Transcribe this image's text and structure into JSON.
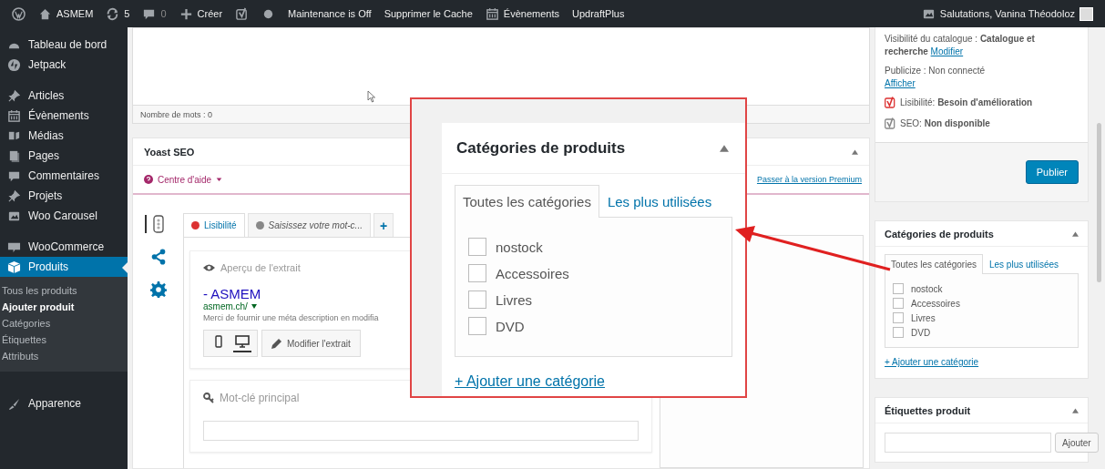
{
  "top_bar": {
    "items": [
      {
        "kind": "logo"
      },
      {
        "kind": "home",
        "label": "ASMEM"
      },
      {
        "kind": "updates",
        "label": "5"
      },
      {
        "kind": "comments",
        "label": "0"
      },
      {
        "kind": "new",
        "label": "Créer"
      },
      {
        "kind": "yoast"
      },
      {
        "kind": "status"
      },
      {
        "kind": "text",
        "label": "Maintenance is Off"
      },
      {
        "kind": "text",
        "label": "Supprimer le Cache"
      },
      {
        "kind": "calendar",
        "label": "Évènements"
      },
      {
        "kind": "text",
        "label": "UpdraftPlus"
      }
    ],
    "account": {
      "greeting": "Salutations, Vanina Théodoloz"
    }
  },
  "sidebar": {
    "groups": [
      [
        {
          "kind": "dashboard",
          "label": "Tableau de bord",
          "selected": false
        },
        {
          "kind": "jetpack",
          "label": "Jetpack",
          "selected": false
        }
      ],
      [
        {
          "kind": "pin",
          "label": "Articles",
          "selected": false
        },
        {
          "kind": "calendar",
          "label": "Évènements",
          "selected": false
        },
        {
          "kind": "media",
          "label": "Médias",
          "selected": false
        },
        {
          "kind": "pages",
          "label": "Pages",
          "selected": false
        },
        {
          "kind": "comments",
          "label": "Commentaires",
          "selected": false
        },
        {
          "kind": "pin",
          "label": "Projets",
          "selected": false
        },
        {
          "kind": "slides",
          "label": "Woo Carousel",
          "selected": false
        }
      ],
      [
        {
          "kind": "woo",
          "label": "WooCommerce",
          "selected": false
        },
        {
          "kind": "box",
          "label": "Produits",
          "selected": true,
          "children": [
            {
              "label": "Tous les produits",
              "selected": false
            },
            {
              "label": "Ajouter produit",
              "selected": true
            },
            {
              "label": "Catégories",
              "selected": false
            },
            {
              "label": "Étiquettes",
              "selected": false
            },
            {
              "label": "Attributs",
              "selected": false
            }
          ]
        }
      ],
      [
        {
          "kind": "brush",
          "label": "Apparence",
          "selected": false
        }
      ]
    ]
  },
  "editor": {
    "word_count": "Nombre de mots : 0"
  },
  "yoast": {
    "title": "Yoast SEO",
    "help_label": "Centre d'aide",
    "premium_link": "Passer à la version Premium",
    "side_tabs": [
      {
        "kind": "readability",
        "selected": true
      },
      {
        "kind": "social",
        "selected": false
      },
      {
        "kind": "settings",
        "selected": false
      }
    ],
    "tabs": [
      {
        "label": "Lisibilité",
        "color": "#dc3232",
        "selected": true,
        "kind": "analysis"
      },
      {
        "label": "Saisissez votre mot-c...",
        "color": "#888888",
        "selected": false,
        "kind": "analysis"
      },
      {
        "label": "+",
        "selected": false,
        "kind": "add"
      }
    ],
    "snippet": {
      "heading": "Aperçu de l'extrait",
      "title": "- ASMEM",
      "url": "asmem.ch/",
      "description": "Merci de fournir une méta description en modifia",
      "devices": [
        {
          "kind": "mobile",
          "selected": false
        },
        {
          "kind": "desktop",
          "selected": true
        }
      ],
      "edit_button": "Modifier l'extrait"
    },
    "keyword": {
      "label": "Mot-clé principal"
    }
  },
  "publish": {
    "visibility": "Visibilité du catalogue : **Catalogue et recherche**",
    "visibility_link": "Modifier",
    "publicize": "Publicize : Non connecté",
    "publicize_link": "Afficher",
    "scores": [
      {
        "text": "Lisibilité: **Besoin d'amélioration**",
        "color": "#dc3232"
      },
      {
        "text": "SEO: **Non disponible**",
        "color": "#888888"
      }
    ],
    "button": "Publier"
  },
  "categories": {
    "title": "Catégories de produits",
    "tabs": [
      {
        "label": "Toutes les catégories",
        "selected": true
      },
      {
        "label": "Les plus utilisées",
        "selected": false
      }
    ],
    "items": [
      {
        "label": "nostock",
        "checked": false
      },
      {
        "label": "Accessoires",
        "checked": false
      },
      {
        "label": "Livres",
        "checked": false
      },
      {
        "label": "DVD",
        "checked": false
      }
    ],
    "add_link": "+ Ajouter une catégorie"
  },
  "tags": {
    "title": "Étiquettes produit",
    "button": "Ajouter"
  },
  "callout": {
    "title": "Catégories de produits",
    "tabs": [
      {
        "label": "Toutes les catégories",
        "selected": true
      },
      {
        "label": "Les plus utilisées",
        "selected": false
      }
    ],
    "items": [
      {
        "label": "nostock",
        "checked": false
      },
      {
        "label": "Accessoires",
        "checked": false
      },
      {
        "label": "Livres",
        "checked": false
      },
      {
        "label": "DVD",
        "checked": false
      }
    ],
    "add_link": "+ Ajouter une catégorie"
  }
}
